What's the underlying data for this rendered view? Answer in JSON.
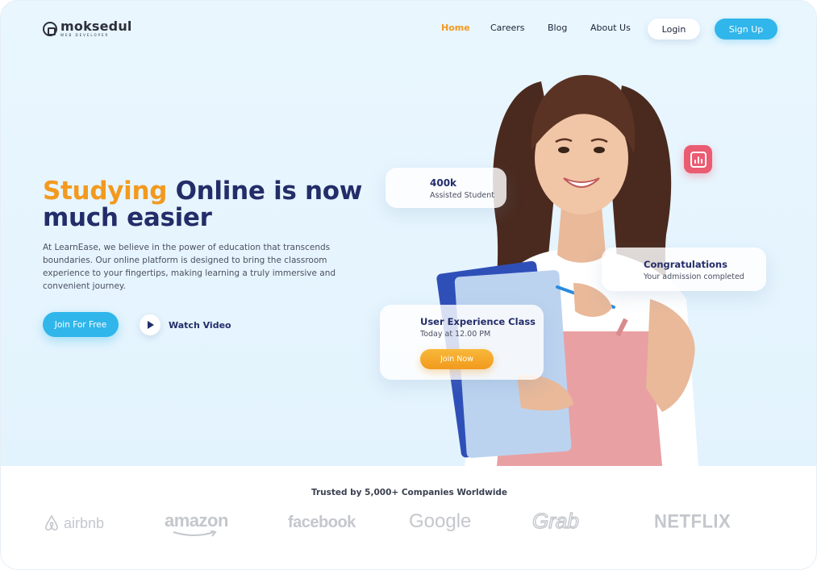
{
  "brand": {
    "name": "moksedul",
    "tagline": "WEB DEVELOPER"
  },
  "nav": {
    "links": [
      "Home",
      "Careers",
      "Blog",
      "About Us"
    ],
    "active": "Home",
    "login": "Login",
    "signup": "Sign Up"
  },
  "hero": {
    "headline_highlight": "Studying",
    "headline_rest_1": " Online is now",
    "headline_rest_2": "much easier",
    "description": "At LearnEase, we believe in the power of education that transcends boundaries. Our online platform is designed to bring the classroom experience to your fingertips, making learning a truly immersive and convenient journey.",
    "join_button": "Join For Free",
    "watch_video": "Watch Video"
  },
  "cards": {
    "students": {
      "value": "400k",
      "label": "Assisted Student"
    },
    "congrats": {
      "title": "Congratulations",
      "subtitle": "Your admission completed"
    },
    "class": {
      "title": "User Experience Class",
      "time": "Today at 12.00 PM",
      "button": "Join Now"
    }
  },
  "trusted": {
    "text": "Trusted by 5,000+ Companies Worldwide",
    "logos": [
      "airbnb",
      "amazon",
      "facebook",
      "Google",
      "Grab",
      "NETFLIX"
    ]
  },
  "colors": {
    "accent_orange": "#f29a1f",
    "navy": "#232d69",
    "primary_blue": "#30b6ea",
    "badge_pink": "#ea5c72",
    "hero_bg": "#e6f4fd"
  },
  "icons": [
    "logo-icon",
    "play-icon",
    "bar-chart-icon",
    "airbnb-logo-icon"
  ]
}
